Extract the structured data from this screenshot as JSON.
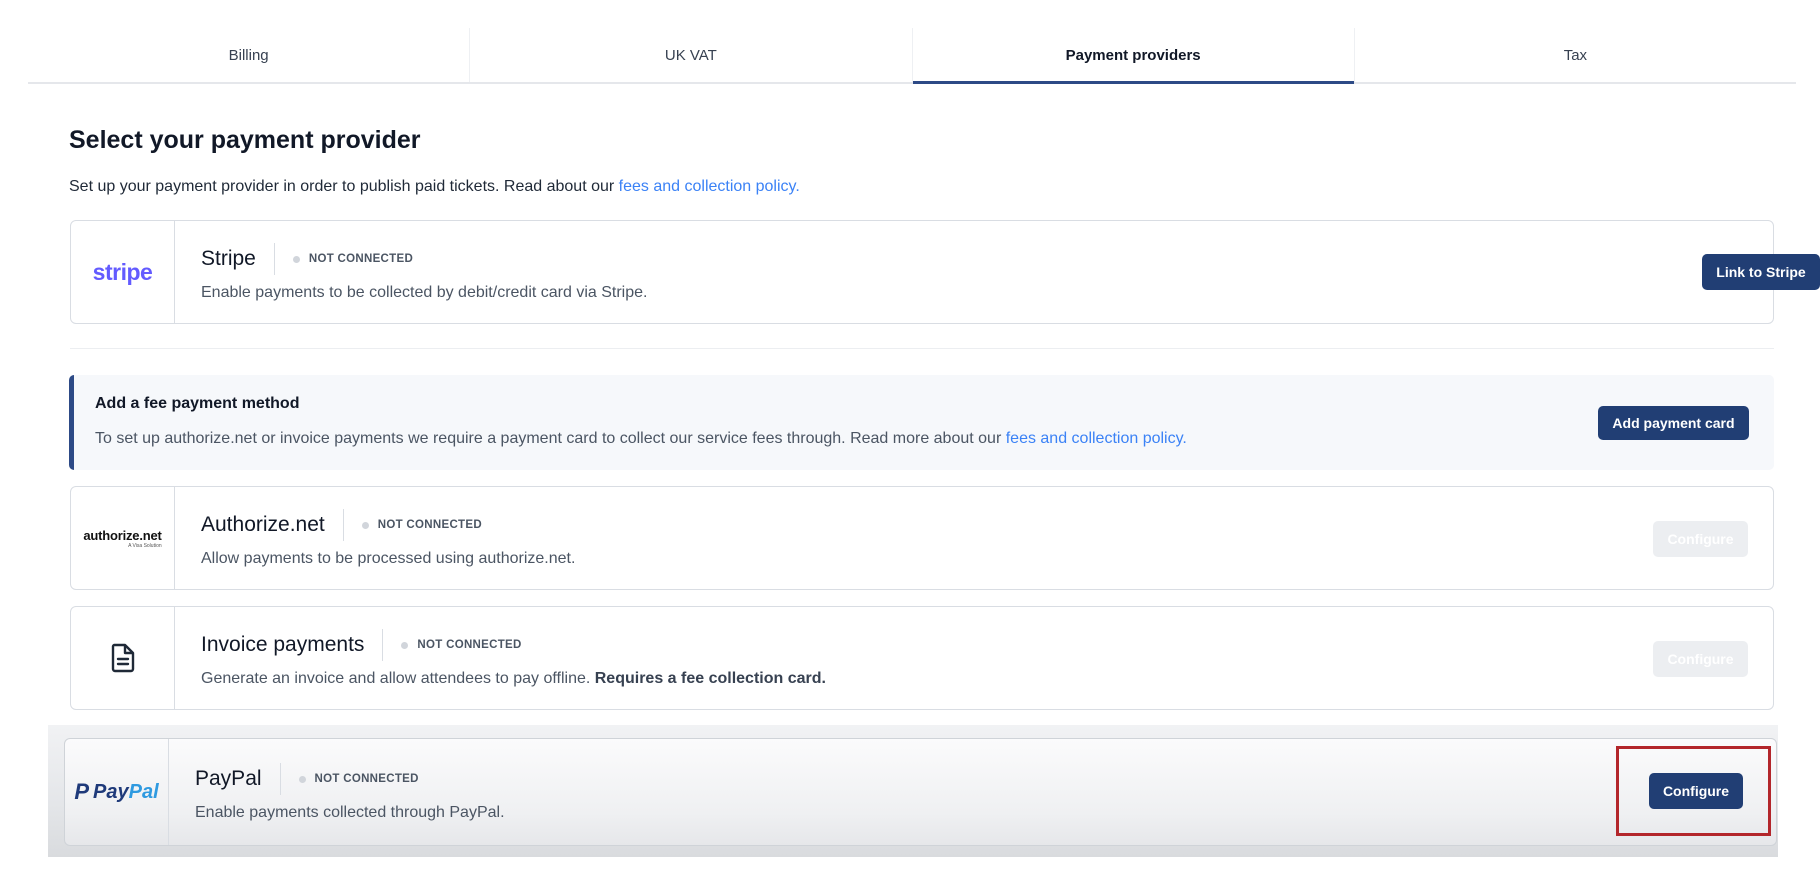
{
  "tabs": [
    {
      "label": "Billing",
      "active": false
    },
    {
      "label": "UK VAT",
      "active": false
    },
    {
      "label": "Payment providers",
      "active": true
    },
    {
      "label": "Tax",
      "active": false
    }
  ],
  "header": {
    "title": "Select your payment provider",
    "subtitle_text": "Set up your payment provider in order to publish paid tickets. Read about our ",
    "subtitle_link": "fees and collection policy."
  },
  "providers": {
    "stripe": {
      "logo_text": "stripe",
      "name": "Stripe",
      "status": "NOT CONNECTED",
      "description": "Enable payments to be collected by debit/credit card via Stripe.",
      "button": "Link to Stripe"
    },
    "authorize": {
      "logo_main": "authorize.net",
      "logo_tag": "A Visa Solution",
      "name": "Authorize.net",
      "status": "NOT CONNECTED",
      "description": "Allow payments to be processed using authorize.net.",
      "button": "Configure"
    },
    "invoice": {
      "logo_icon": "document-icon",
      "name": "Invoice payments",
      "status": "NOT CONNECTED",
      "description": "Generate an invoice and allow attendees to pay offline. ",
      "description_bold": "Requires a fee collection card.",
      "button": "Configure"
    },
    "paypal": {
      "logo_pay": "Pay",
      "logo_pal": "Pal",
      "name": "PayPal",
      "status": "NOT CONNECTED",
      "description": "Enable payments collected through PayPal.",
      "button": "Configure"
    }
  },
  "fee_banner": {
    "title": "Add a fee payment method",
    "text": "To set up authorize.net or invoice payments we require a payment card to collect our service fees through. Read more about our ",
    "link": "fees and collection policy.",
    "button": "Add payment card"
  },
  "colors": {
    "primary": "#213e74",
    "link": "#3b82f6",
    "stripe": "#635bff",
    "highlight": "#b3262b"
  }
}
